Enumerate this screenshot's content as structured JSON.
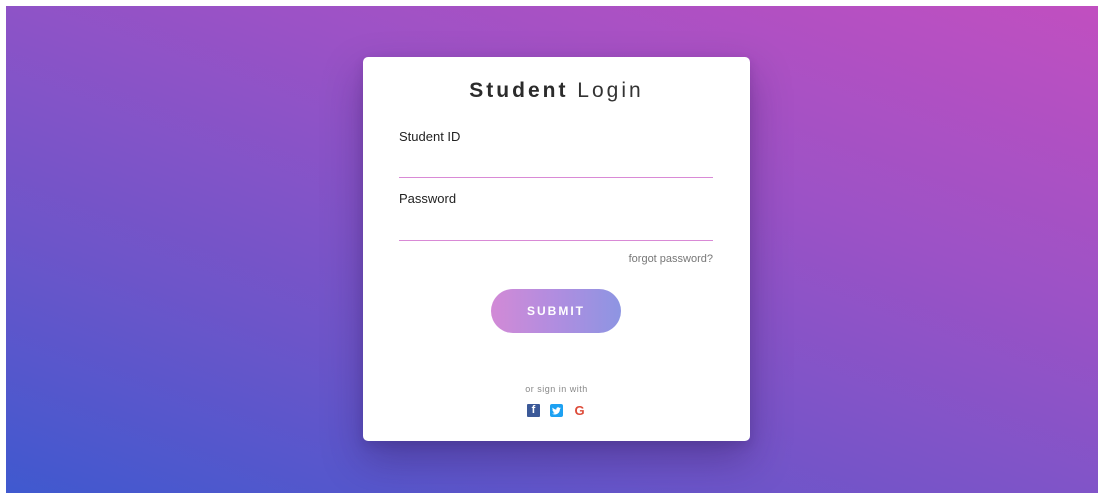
{
  "login": {
    "title_bold": "Student",
    "title_light": "Login",
    "student_id_label": "Student ID",
    "student_id_value": "",
    "password_label": "Password",
    "password_value": "",
    "forgot_label": "forgot password?",
    "submit_label": "SUBMIT",
    "or_sign_in_label": "or sign in with",
    "socials": {
      "facebook_icon": "facebook-icon",
      "twitter_icon": "twitter-icon",
      "google_icon": "google-icon",
      "facebook_glyph": "f",
      "google_glyph": "G"
    }
  },
  "colors": {
    "gradient_start": "#3f59cf",
    "gradient_end": "#c14fc0",
    "input_underline": "#d98ad6",
    "facebook": "#3b5998",
    "twitter": "#1da1f2",
    "google": "#dd4b39"
  }
}
